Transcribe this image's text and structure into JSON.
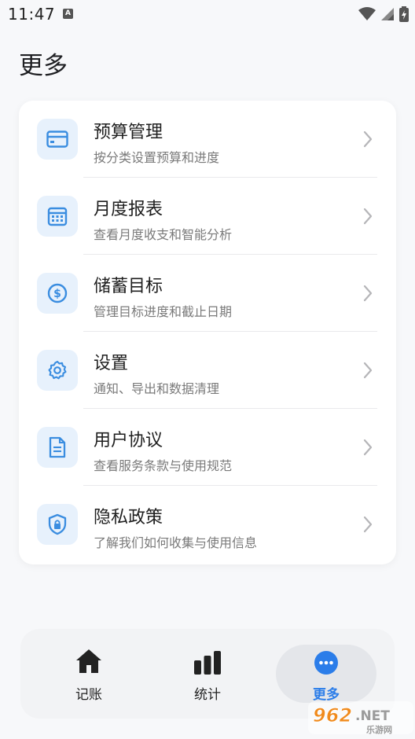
{
  "status_bar": {
    "time": "11:47",
    "notif_badge": "A"
  },
  "page": {
    "title": "更多"
  },
  "menu": [
    {
      "title": "预算管理",
      "subtitle": "按分类设置预算和进度",
      "icon": "credit-card-icon"
    },
    {
      "title": "月度报表",
      "subtitle": "查看月度收支和智能分析",
      "icon": "calendar-icon"
    },
    {
      "title": "储蓄目标",
      "subtitle": "管理目标进度和截止日期",
      "icon": "dollar-circle-icon"
    },
    {
      "title": "设置",
      "subtitle": "通知、导出和数据清理",
      "icon": "gear-icon"
    },
    {
      "title": "用户协议",
      "subtitle": "查看服务条款与使用规范",
      "icon": "document-icon"
    },
    {
      "title": "隐私政策",
      "subtitle": "了解我们如何收集与使用信息",
      "icon": "shield-lock-icon"
    }
  ],
  "bottom_nav": {
    "tabs": [
      {
        "label": "记账",
        "icon": "home-icon",
        "active": false
      },
      {
        "label": "统计",
        "icon": "bar-chart-icon",
        "active": false
      },
      {
        "label": "更多",
        "icon": "more-dots-icon",
        "active": true
      }
    ]
  },
  "watermark": {
    "text": "962.NET",
    "sub": "乐游网"
  },
  "colors": {
    "accent": "#2b7de9",
    "icon_bg": "#e7f1fc",
    "card_bg": "#ffffff",
    "page_bg": "#f7f8fa"
  }
}
